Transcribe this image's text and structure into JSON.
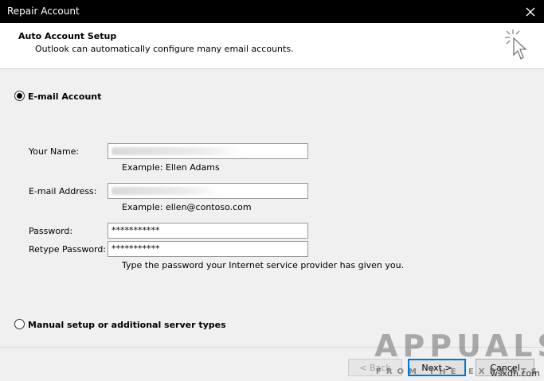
{
  "window": {
    "title": "Repair Account"
  },
  "header": {
    "title": "Auto Account Setup",
    "subtitle": "Outlook can automatically configure many email accounts."
  },
  "email_account": {
    "label": "E-mail Account",
    "selected": true,
    "name_label": "Your Name:",
    "name_example": "Example: Ellen Adams",
    "email_label": "E-mail Address:",
    "email_example": "Example: ellen@contoso.com",
    "password_label": "Password:",
    "password_value": "***********",
    "retype_label": "Retype Password:",
    "retype_value": "***********",
    "password_hint": "Type the password your Internet service provider has given you."
  },
  "manual_setup": {
    "label": "Manual setup or additional server types",
    "selected": false
  },
  "buttons": {
    "back": "< Back",
    "next": "Next >",
    "cancel": "Cancel"
  },
  "watermark": {
    "brand": "APPUALS",
    "tagline": "FROM THE EXPERTS",
    "site": "wsxdn.com"
  },
  "colors": {
    "titlebar": "#000000",
    "default_button_border": "#0078d7"
  }
}
